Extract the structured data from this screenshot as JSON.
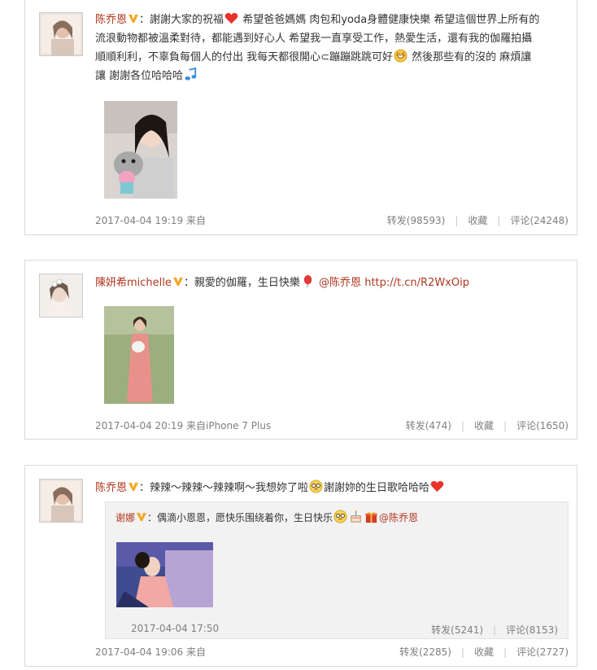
{
  "posts": [
    {
      "author": "陈乔恩",
      "text_lines": [
        "謝謝大家的祝福",
        "希望爸爸媽媽 肉包和yoda身體健康快樂 希望這個世界上所有的",
        "流浪動物都被溫柔對待，都能遇到好心人 希望我一直享受工作，熱愛生活，還有我的伽羅拍攝",
        "順順利利，不辜負每個人的付出 我每天都很開心⊂蹦蹦跳跳可好",
        "然後那些有的沒的 麻煩讓",
        "讓 謝謝各位哈哈哈"
      ],
      "time": "2017-04-04 19:19",
      "source": "来自",
      "repost_label": "转发(98593)",
      "fav_label": "收藏",
      "comment_label": "评论(24248)"
    },
    {
      "author": "陳妍希michelle",
      "text_before": "：親愛的伽羅，生日快樂",
      "mention": "@陈乔恩",
      "url": "http://t.cn/R2WxOip",
      "time": "2017-04-04 20:19",
      "source": "来自iPhone 7 Plus",
      "repost_label": "转发(474)",
      "fav_label": "收藏",
      "comment_label": "评论(1650)"
    },
    {
      "author": "陈乔恩",
      "text_before": "：辣辣～辣辣～辣辣啊～我想妳了啦",
      "text_after": "謝謝妳的生日歌哈哈哈",
      "repost": {
        "author": "谢娜",
        "text": "：偶滴小恩恩，愿快乐围绕着你，生日快乐",
        "mention": "@陈乔恩",
        "time": "2017-04-04 17:50",
        "repost_label": "转发(5241)",
        "comment_label": "评论(8153)"
      },
      "time": "2017-04-04 19:06",
      "source": "来自",
      "repost_label": "转发(2285)",
      "fav_label": "收藏",
      "comment_label": "评论(2727)"
    }
  ],
  "colors": {
    "name": "#b0371e",
    "meta": "#7f7f7f",
    "border": "#d9d9d9"
  }
}
